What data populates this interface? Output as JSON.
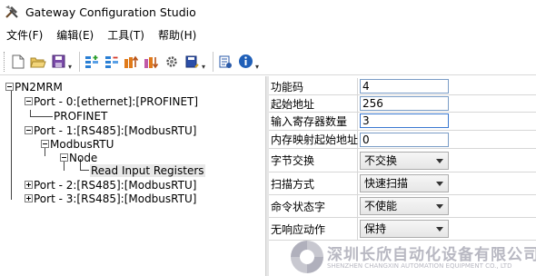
{
  "window": {
    "title": "Gateway Configuration Studio"
  },
  "menu": [
    {
      "label": "文件(F)"
    },
    {
      "label": "编辑(E)"
    },
    {
      "label": "工具(T)"
    },
    {
      "label": "帮助(H)"
    }
  ],
  "toolbar": {
    "buttons": [
      "new-file-icon",
      "open-folder-icon",
      "save-icon",
      "add-node-icon",
      "remove-node-icon",
      "upload-icon",
      "download-icon",
      "settings-icon",
      "export-icon",
      "config-icon",
      "info-icon"
    ]
  },
  "tree": {
    "root": "PN2MRM",
    "port0": "Port - 0:[ethernet]:[PROFINET]",
    "port0_child": "PROFINET",
    "port1": "Port - 1:[RS485]:[ModbusRTU]",
    "port1_child": "ModbusRTU",
    "node": "Node",
    "node_child": "Read Input Registers",
    "port2": "Port - 2:[RS485]:[ModbusRTU]",
    "port3": "Port - 3:[RS485]:[ModbusRTU]"
  },
  "properties": {
    "function_code": {
      "label": "功能码",
      "value": "4"
    },
    "start_address": {
      "label": "起始地址",
      "value": "256"
    },
    "input_register_count": {
      "label": "输入寄存器数量",
      "value": "3"
    },
    "memory_map_start": {
      "label": "内存映射起始地址",
      "value": "0"
    },
    "byte_swap": {
      "label": "字节交换",
      "value": "不交换"
    },
    "scan_mode": {
      "label": "扫描方式",
      "value": "快速扫描"
    },
    "command_status": {
      "label": "命令状态字",
      "value": "不使能"
    },
    "no_response_action": {
      "label": "无响应动作",
      "value": "保持"
    }
  },
  "watermark": {
    "cn": "深圳长欣自动化设备有限公司",
    "en": "SHENZHEN CHANGXIN AUTOMATION EQUIPMENT CO., LTD"
  }
}
